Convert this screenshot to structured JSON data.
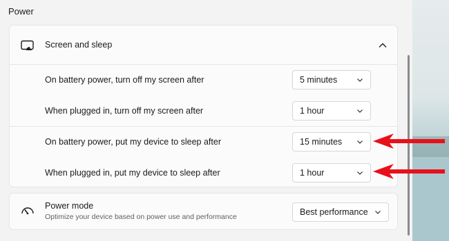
{
  "section_title": "Power",
  "screen_sleep": {
    "title": "Screen and sleep",
    "monitor_icon": "monitor-sleep-icon",
    "collapse_icon": "chevron-up-icon",
    "rows": [
      {
        "label": "On battery power, turn off my screen after",
        "value": "5 minutes"
      },
      {
        "label": "When plugged in, turn off my screen after",
        "value": "1 hour"
      },
      {
        "label": "On battery power, put my device to sleep after",
        "value": "15 minutes"
      },
      {
        "label": "When plugged in, put my device to sleep after",
        "value": "1 hour"
      }
    ]
  },
  "power_mode": {
    "title": "Power mode",
    "subtitle": "Optimize your device based on power use and performance",
    "value": "Best performance",
    "icon": "gauge-icon"
  },
  "annotations": {
    "arrow_color": "#e8101a"
  },
  "colors": {
    "background": "#f3f3f3",
    "card": "#fbfbfb",
    "border": "#e5e5e5"
  }
}
